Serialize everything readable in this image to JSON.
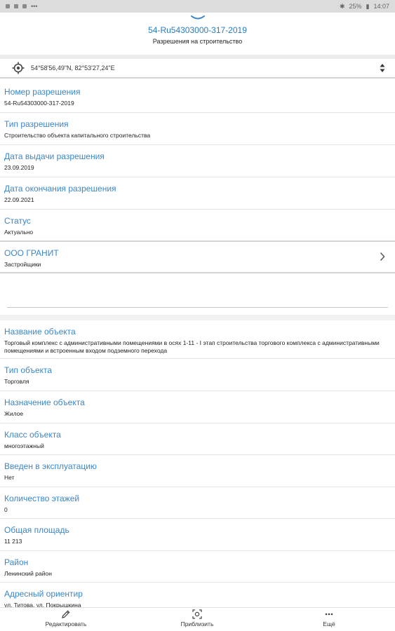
{
  "status_bar": {
    "battery": "25%",
    "time": "14:07"
  },
  "header": {
    "title": "54-Ru54303000-317-2019",
    "subtitle": "Разрешения на строительство"
  },
  "location": {
    "coords": "54°58'56,49\"N, 82°53'27,24\"E"
  },
  "fields_top": [
    {
      "label": "Номер разрешения",
      "value": "54-Ru54303000-317-2019"
    },
    {
      "label": "Тип разрешения",
      "value": "Строительство объекта капитального строительства"
    },
    {
      "label": "Дата выдачи разрешения",
      "value": "23.09.2019"
    },
    {
      "label": "Дата окончания разрешения",
      "value": "22.09.2021"
    },
    {
      "label": "Статус",
      "value": "Актуально"
    },
    {
      "label": "ООО ГРАНИТ",
      "value": "Застройщики"
    }
  ],
  "fields_bottom": [
    {
      "label": "Название объекта",
      "value": "Торговый комплекс с административными помещениями в осях 1-11 - I этап строительства торгового комплекса с административными помещениями и встроенным входом подземного перехода"
    },
    {
      "label": "Тип объекта",
      "value": "Торговля"
    },
    {
      "label": "Назначение объекта",
      "value": "Жилое"
    },
    {
      "label": "Класс объекта",
      "value": "многоэтажный"
    },
    {
      "label": "Введен в эксплуатацию",
      "value": "Нет"
    },
    {
      "label": "Количество этажей",
      "value": "0"
    },
    {
      "label": "Общая площадь",
      "value": "11 213"
    },
    {
      "label": "Район",
      "value": "Ленинский район"
    },
    {
      "label": "Адресный ориентир",
      "value": "ул. Титова, ул. Покрышкина"
    }
  ],
  "bottom_bar": {
    "edit": "Редактировать",
    "zoom": "Приблизить",
    "more": "Ещё"
  },
  "colors": {
    "accent": "#3a86c8",
    "title": "#2a7bbf"
  }
}
